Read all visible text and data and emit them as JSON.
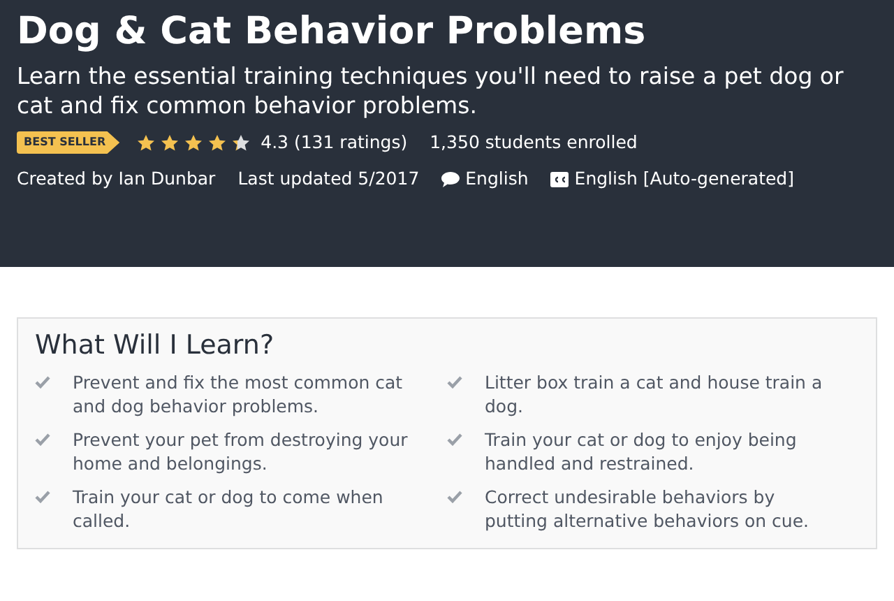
{
  "course": {
    "title": "Dog & Cat Behavior Problems",
    "subtitle": "Learn the essential training techniques you'll need to raise a pet dog or cat and fix common behavior problems.",
    "badge": "BEST SELLER",
    "stars": 4.3,
    "rating": "4.3 (131 ratings)",
    "enrolled": "1,350 students enrolled",
    "author": "Created by Ian Dunbar",
    "updated": "Last updated 5/2017",
    "language": "English",
    "captions": "English [Auto-generated]"
  },
  "learn": {
    "title": "What Will I Learn?",
    "items": [
      "Prevent and fix the most common cat and dog behavior problems.",
      "Litter box train a cat and house train a dog.",
      "Prevent your pet from destroying your home and belongings.",
      "Train your cat or dog to enjoy being handled and restrained.",
      "Train your cat or dog to come when called.",
      "Correct undesirable behaviors by putting alternative behaviors on cue."
    ]
  }
}
